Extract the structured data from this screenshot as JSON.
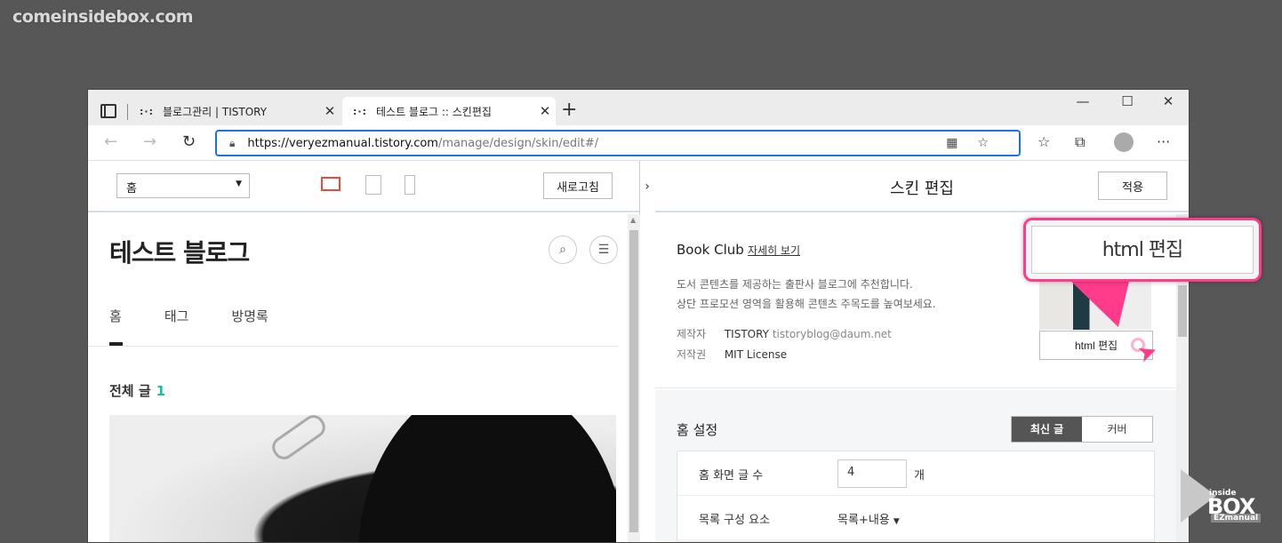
{
  "watermark": "comeinsidebox.com",
  "browser": {
    "tabs": [
      {
        "title": "블로그관리 | TISTORY"
      },
      {
        "title": "테스트 블로그 :: 스킨편집"
      }
    ],
    "url_host": "https://veryezmanual.tistory.com",
    "url_path": "/manage/design/skin/edit#/"
  },
  "left": {
    "page_select": "홈",
    "refresh_label": "새로고침",
    "blog_title": "테스트 블로그",
    "nav": [
      "홈",
      "태그",
      "방명록"
    ],
    "all_posts_label": "전체 글",
    "all_posts_count": "1"
  },
  "right": {
    "title": "스킨 편집",
    "apply_label": "적용",
    "skin_name": "Book Club",
    "detail_link": "자세히 보기",
    "desc_line1": "도서 콘텐츠를 제공하는 출판사 블로그에 추천합니다.",
    "desc_line2": "상단 프로모션 영역을 활용해 콘텐츠 주목도를 높여보세요.",
    "maker_label": "제작자",
    "maker_value": "TISTORY",
    "maker_email": "tistoryblog@daum.net",
    "license_label": "저작권",
    "license_value": "MIT License",
    "html_edit_label": "html 편집",
    "home_settings_title": "홈 설정",
    "seg_recent": "최신 글",
    "seg_cover": "커버",
    "row1_label": "홈 화면 글 수",
    "row1_value": "4",
    "row1_unit": "개",
    "row2_label": "목록 구성 요소",
    "row2_value": "목록+내용"
  },
  "callout": {
    "label": "html 편집"
  },
  "badge": {
    "small": "inside",
    "big": "BOX",
    "ez": "EZmanual"
  },
  "colors": {
    "accent_pink": "#ff3b8b",
    "url_border": "#1a73e8",
    "count_teal": "#1abc9c"
  }
}
